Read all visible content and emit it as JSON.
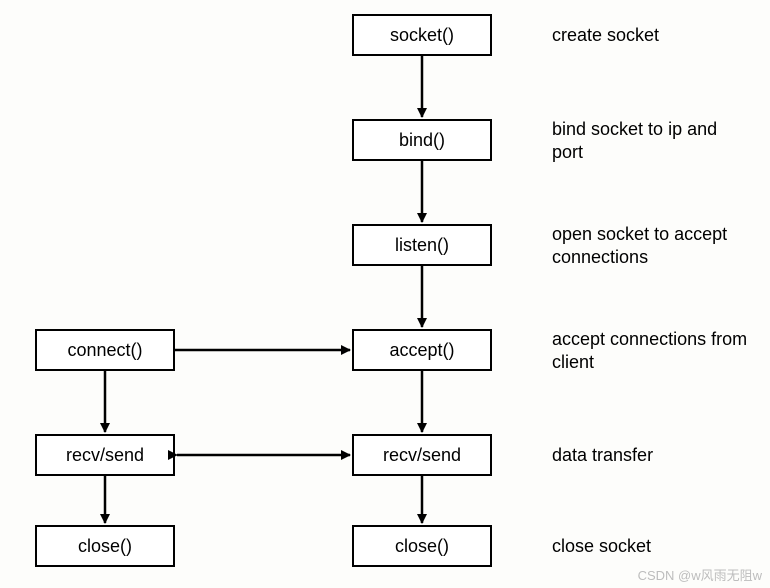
{
  "nodes": {
    "socket": "socket()",
    "bind": "bind()",
    "listen": "listen()",
    "accept": "accept()",
    "recvsend_server": "recv/send",
    "close_server": "close()",
    "connect": "connect()",
    "recvsend_client": "recv/send",
    "close_client": "close()"
  },
  "labels": {
    "create": "create socket",
    "bind": "bind socket to ip and port",
    "listen": "open socket to accept connections",
    "accept": "accept connections from client",
    "transfer": "data transfer",
    "close": "close socket"
  },
  "watermark": "CSDN @w风雨无阻w"
}
